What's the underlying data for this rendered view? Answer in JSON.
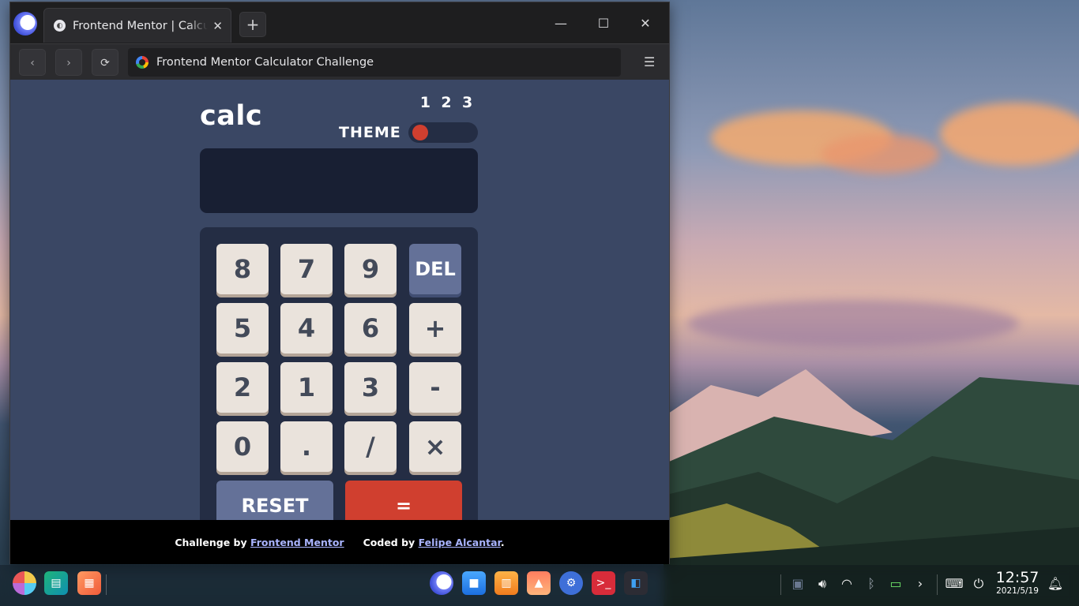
{
  "browser": {
    "tab_title": "Frontend Mentor | Calculator",
    "tab_close": "✕",
    "new_tab": "+",
    "address": "Frontend Mentor Calculator Challenge",
    "controls": {
      "back": "‹",
      "forward": "›",
      "reload": "⟳",
      "minimize": "—",
      "maximize": "☐",
      "close": "✕",
      "menu": "☰"
    }
  },
  "calculator": {
    "logo": "calc",
    "theme_label": "THEME",
    "theme_options": [
      "1",
      "2",
      "3"
    ],
    "theme_selected": "1",
    "display_value": "",
    "keys": {
      "k8": "8",
      "k7": "7",
      "k9": "9",
      "del": "DEL",
      "k5": "5",
      "k4": "4",
      "k6": "6",
      "plus": "+",
      "k2": "2",
      "k1": "1",
      "k3": "3",
      "minus": "-",
      "k0": "0",
      "dot": ".",
      "divide": "/",
      "times": "×",
      "reset": "RESET",
      "equals": "="
    },
    "colors": {
      "page_bg": "#3a4764",
      "keypad_bg": "#242d44",
      "screen_bg": "#181f33",
      "accent_red": "#d03f2f",
      "key_blue": "#647198",
      "key_bg": "#eae3dc"
    }
  },
  "attribution": {
    "challenge_prefix": "Challenge by",
    "challenge_link": "Frontend Mentor",
    "coded_prefix": "Coded by",
    "coded_link": "Felipe Alcantar",
    "suffix": "."
  },
  "taskbar": {
    "time": "12:57",
    "date": "2021/5/19",
    "apps": [
      "launcher-icon",
      "terminal-manager-icon",
      "multitask-icon",
      "browser-icon",
      "file-manager-icon",
      "app-store-icon",
      "photos-icon",
      "settings-icon",
      "terminal-icon",
      "vscode-icon"
    ],
    "tray": [
      "screen-icon",
      "volume-icon",
      "wifi-icon",
      "bluetooth-icon",
      "battery-icon",
      "expand-icon",
      "keyboard-icon",
      "power-icon",
      "notification-icon"
    ]
  }
}
